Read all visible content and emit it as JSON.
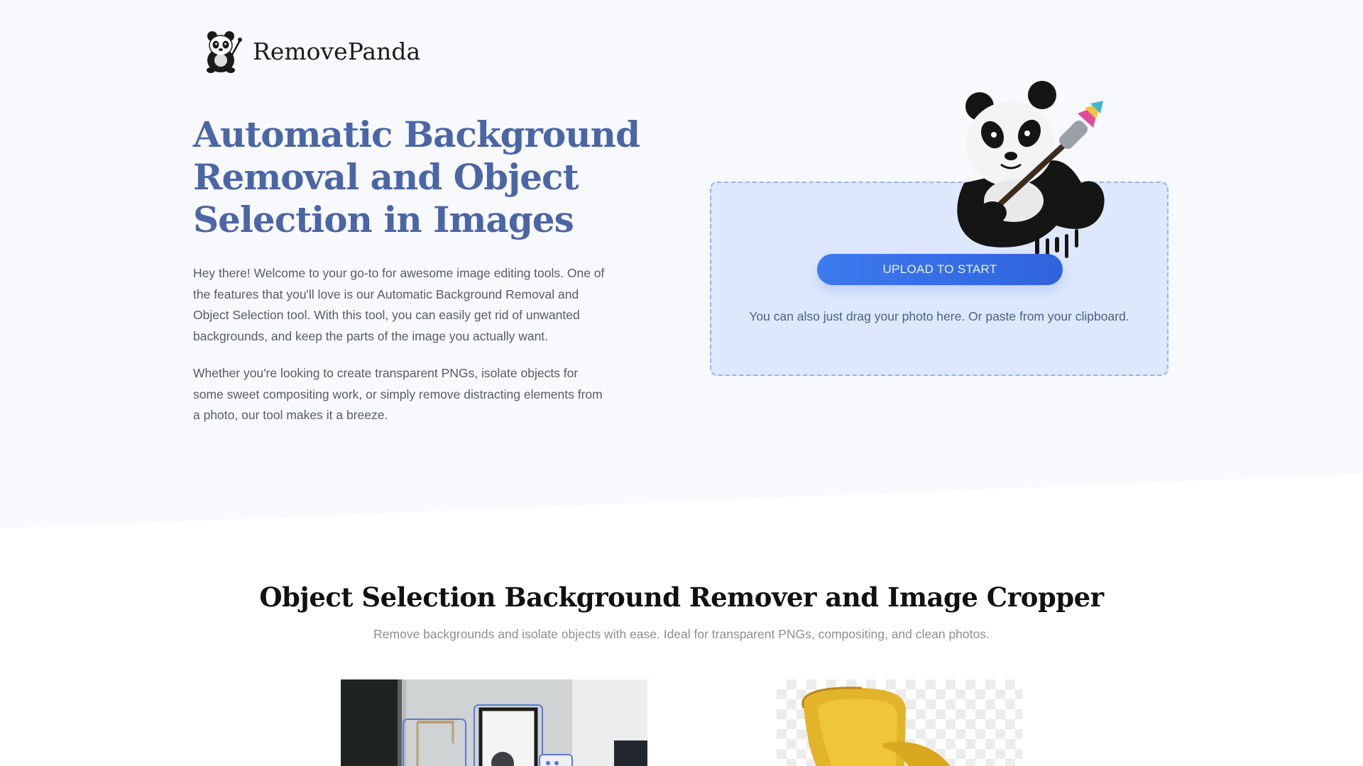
{
  "brand": {
    "name": "RemovePanda",
    "logo_icon": "panda-logo-icon"
  },
  "hero": {
    "title": "Automatic Background Removal and Object Selection in Images",
    "paragraphs": [
      "Hey there! Welcome to your go-to for awesome image editing tools. One of the features that you'll love is our Automatic Background Removal and Object Selection tool. With this tool, you can easily get rid of unwanted backgrounds, and keep the parts of the image you actually want.",
      "Whether you're looking to create transparent PNGs, isolate objects for some sweet compositing work, or simply remove distracting elements from a photo, our tool makes it a breeze."
    ]
  },
  "upload": {
    "button_label": "UPLOAD TO START",
    "hint": "You can also just drag your photo here. Or paste from your clipboard.",
    "illustration": "panda-with-paintbrush"
  },
  "section": {
    "title": "Object Selection Background Remover and Image Cropper",
    "subtitle": "Remove backgrounds and isolate objects with ease. Ideal for transparent PNGs, compositing, and clean photos."
  },
  "examples": [
    {
      "name": "room-interior-example",
      "kind": "photo"
    },
    {
      "name": "yellow-chair-cutout-example",
      "kind": "transparent-png"
    }
  ],
  "colors": {
    "title_accent": "#4b66a6",
    "button": "#3570e6",
    "upload_card_bg": "#dde8fd",
    "upload_card_border": "#8fb8e6",
    "hero_bg": "#f8f9fc"
  }
}
